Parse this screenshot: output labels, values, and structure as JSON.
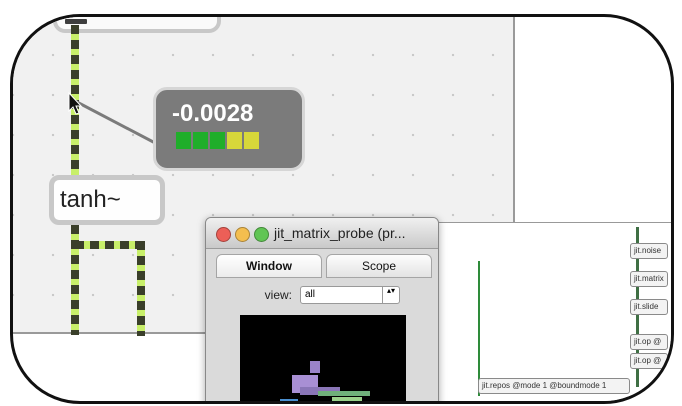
{
  "probe": {
    "value": "-0.0028",
    "meter_colors": [
      "#1fae2a",
      "#1fae2a",
      "#1fae2a",
      "#d7d73a",
      "#d7d73a"
    ]
  },
  "patch": {
    "tanh_label": "tanh~"
  },
  "window": {
    "title": "jit_matrix_probe (pr...",
    "traffic_light_colors": [
      "#ec5f57",
      "#f4be4f",
      "#61c554"
    ],
    "tabs": [
      {
        "label": "Window"
      },
      {
        "label": "Scope"
      }
    ],
    "view_label": "view:",
    "view_value": "all",
    "stepper_glyph": "▴▾"
  },
  "right_objects": [
    {
      "label": "jit.noise"
    },
    {
      "label": "jit.matrix"
    },
    {
      "label": "jit.slide"
    },
    {
      "label": "jit.op @"
    },
    {
      "label": "jit.op @"
    },
    {
      "label": "jit.repos @mode 1 @boundmode 1"
    }
  ]
}
